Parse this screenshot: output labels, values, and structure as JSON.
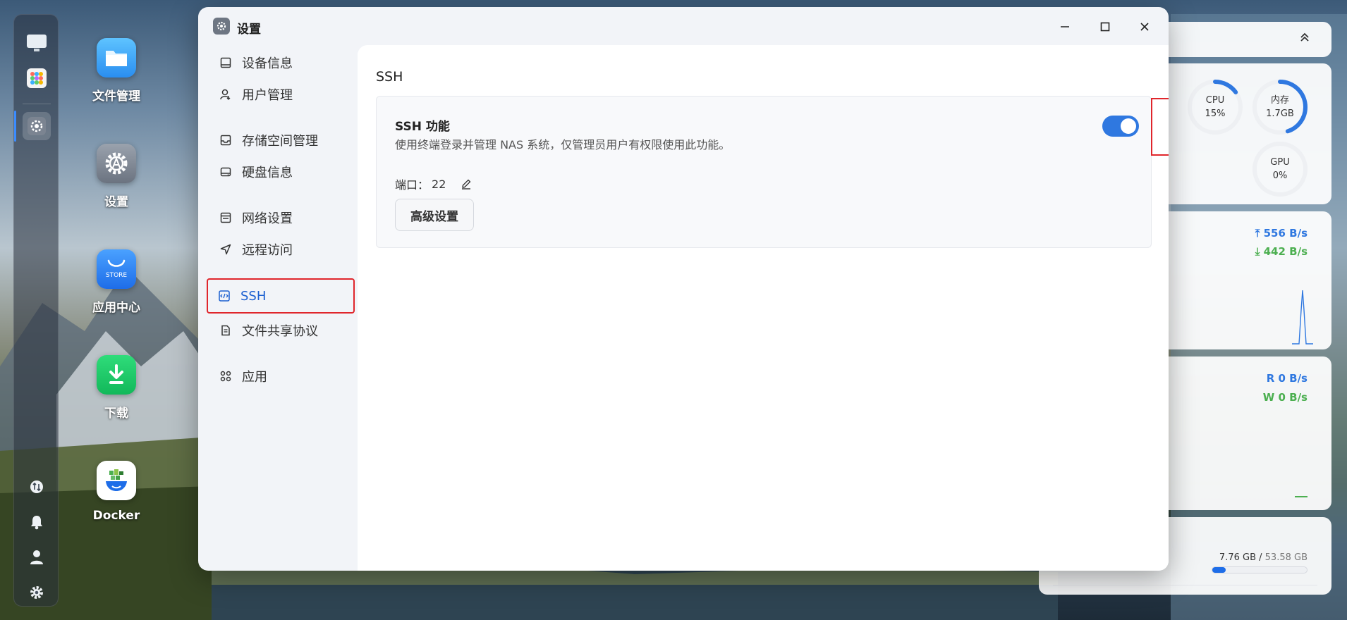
{
  "dock": {
    "items": [
      "desktop-icon",
      "apps-grid-icon",
      "settings-icon"
    ],
    "bottom": [
      "transfer-icon",
      "bell-icon",
      "user-icon",
      "gear-icon"
    ]
  },
  "desktop": {
    "apps": [
      {
        "label": "文件管理",
        "icon": "folder-icon"
      },
      {
        "label": "设置",
        "icon": "settings-icon"
      },
      {
        "label": "应用中心",
        "icon": "store-icon",
        "icon_text": "STORE"
      },
      {
        "label": "下载",
        "icon": "download-icon"
      },
      {
        "label": "Docker",
        "icon": "docker-icon"
      }
    ]
  },
  "widgets": {
    "cpu": {
      "label": "CPU",
      "value": "15%",
      "fraction": 0.15
    },
    "memory": {
      "label": "内存",
      "value": "1.7GB",
      "fraction": 0.45
    },
    "gpu": {
      "label": "GPU",
      "value": "0%",
      "fraction": 0
    },
    "network": {
      "upload": "556 B/s",
      "download": "442 B/s"
    },
    "disk_io": {
      "read": "R  0 B/s",
      "write": "W  0 B/s"
    },
    "storage": {
      "used": "7.76 GB",
      "separator": " / ",
      "total": "53.58 GB",
      "fraction": 0.145
    },
    "colors": {
      "blue": "#2f78e0",
      "green": "#4caf50"
    }
  },
  "window": {
    "title": "设置",
    "controls": [
      "minimize-icon",
      "maximize-icon",
      "close-icon"
    ]
  },
  "sidebar": {
    "items": [
      {
        "label": "设备信息",
        "icon": "monitor-icon"
      },
      {
        "label": "用户管理",
        "icon": "user-icon"
      },
      {
        "label": "存储空间管理",
        "icon": "storage-icon"
      },
      {
        "label": "硬盘信息",
        "icon": "disk-icon"
      },
      {
        "label": "网络设置",
        "icon": "network-icon"
      },
      {
        "label": "远程访问",
        "icon": "send-icon"
      },
      {
        "label": "SSH",
        "icon": "code-icon",
        "active": true
      },
      {
        "label": "文件共享协议",
        "icon": "file-icon"
      },
      {
        "label": "应用",
        "icon": "apps-icon"
      }
    ]
  },
  "main": {
    "title": "SSH",
    "ssh_function_label": "SSH 功能",
    "description": "使用终端登录并管理 NAS 系统，仅管理员用户有权限使用此功能。",
    "port_label": "端口：",
    "port_value": "22",
    "advanced_button": "高级设置",
    "ssh_enabled": true
  }
}
